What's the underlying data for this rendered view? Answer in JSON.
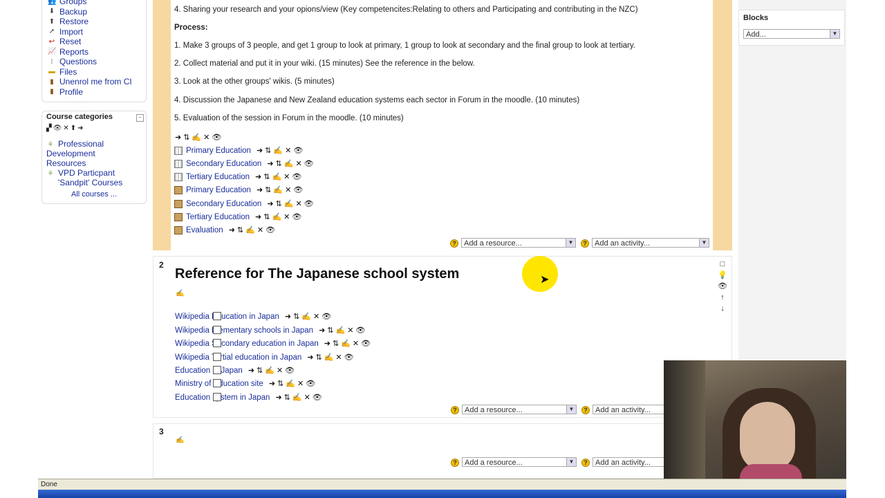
{
  "admin": {
    "items": [
      {
        "label": "Groups",
        "icon": "groups-icon"
      },
      {
        "label": "Backup",
        "icon": "backup-icon"
      },
      {
        "label": "Restore",
        "icon": "restore-icon"
      },
      {
        "label": "Import",
        "icon": "import-icon"
      },
      {
        "label": "Reset",
        "icon": "reset-icon"
      },
      {
        "label": "Reports",
        "icon": "reports-icon"
      },
      {
        "label": "Questions",
        "icon": "questions-icon"
      },
      {
        "label": "Files",
        "icon": "folder-icon"
      },
      {
        "label": "Unenrol me from CI",
        "icon": "unenrol-icon"
      },
      {
        "label": "Profile",
        "icon": "profile-icon"
      }
    ]
  },
  "categories": {
    "title": "Course categories",
    "collapse": "−",
    "items": [
      {
        "label": "Professional Development",
        "label2": "Resources"
      },
      {
        "label": "VPD Particpant",
        "label2": "'Sandpit' Courses"
      }
    ],
    "all": "All courses ..."
  },
  "section1": {
    "lines": [
      "4. Sharing your research and your opions/view (Key competencites:Relating to others and Participating and contributing in the NZC)",
      "Process:",
      "1. Make 3 groups of 3 people, and get 1 group to look at primary, 1 group to look at secondary and the final group to look at tertiary.",
      "2. Collect material and put it in your wiki. (15 minutes) See the reference in the below.",
      "3. Look at the other groups' wikis. (5 minutes)",
      "4. Discussion the Japanese and New Zealand education systems each sector in Forum in the moodle. (10 minutes)",
      "5. Evaluation of the session in Forum in the moodle. (10 minutes)"
    ],
    "edit_icons": "➜⇅✍✕👁",
    "resources": [
      {
        "label": "Primary Education",
        "type": "wiki"
      },
      {
        "label": "Secondary Education",
        "type": "wiki"
      },
      {
        "label": "Tertiary Education",
        "type": "wiki"
      },
      {
        "label": "Primary Education",
        "type": "forum"
      },
      {
        "label": "Secondary Education",
        "type": "forum"
      },
      {
        "label": "Tertiary Education",
        "type": "forum"
      },
      {
        "label": "Evaluation",
        "type": "forum"
      }
    ],
    "add_resource": "Add a resource...",
    "add_activity": "Add an activity..."
  },
  "section2": {
    "number": "2",
    "title": "Reference for The Japanese school system",
    "resources": [
      {
        "label": "Wikipedia Education in Japan"
      },
      {
        "label": "Wikipedia Elementary schools in Japan"
      },
      {
        "label": "Wikipedia Secondary education in Japan"
      },
      {
        "label": "Wikipedia Tertial education in Japan"
      },
      {
        "label": "Education in Japan"
      },
      {
        "label": "Ministry of Education site"
      },
      {
        "label": "Education system in Japan"
      }
    ],
    "add_resource": "Add a resource...",
    "add_activity": "Add an activity..."
  },
  "section3": {
    "number": "3",
    "add_resource": "Add a resource...",
    "add_activity": "Add an activity..."
  },
  "blocks": {
    "title": "Blocks",
    "select": "Add..."
  },
  "status": "Done"
}
